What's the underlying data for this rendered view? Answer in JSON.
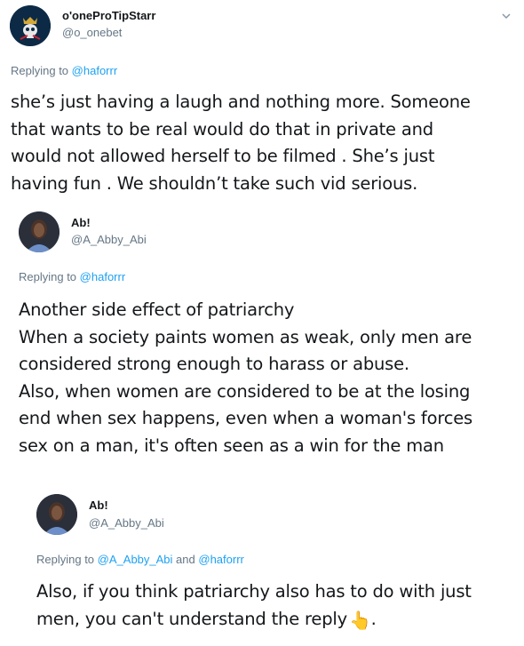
{
  "tweet1": {
    "name": "o'oneProTipStarr",
    "handle": "@o_onebet",
    "reply_prefix": "Replying to",
    "reply_mention": "@haforrr",
    "lines": [
      "she’s just having a laugh and nothing more. Someone",
      "that wants to be real would do that in private and",
      "would not allowed herself to be filmed . She’s just",
      "having fun . We shouldn’t take such vid serious."
    ],
    "menu_icon": "chevron-down-icon"
  },
  "tweet2": {
    "name": "Ab!",
    "handle": "@A_Abby_Abi",
    "reply_prefix": "Replying to",
    "reply_mention": "@haforrr",
    "lines": [
      "Another side effect of patriarchy",
      "When a society paints women as weak, only men are",
      "considered strong enough to harass or abuse.",
      "Also, when women are considered to be at the losing",
      "end when sex happens, even when a woman's forces",
      "sex on a man, it's often seen as a win for the man"
    ]
  },
  "tweet3": {
    "name": "Ab!",
    "handle": "@A_Abby_Abi",
    "reply_prefix": "Replying to",
    "reply_mention_1": "@A_Abby_Abi",
    "reply_and": "and",
    "reply_mention_2": "@haforrr",
    "lines": [
      "Also, if you think patriarchy also has to do with just",
      "men, you can't understand the reply"
    ],
    "emoji": "👆",
    "trailing": "."
  }
}
